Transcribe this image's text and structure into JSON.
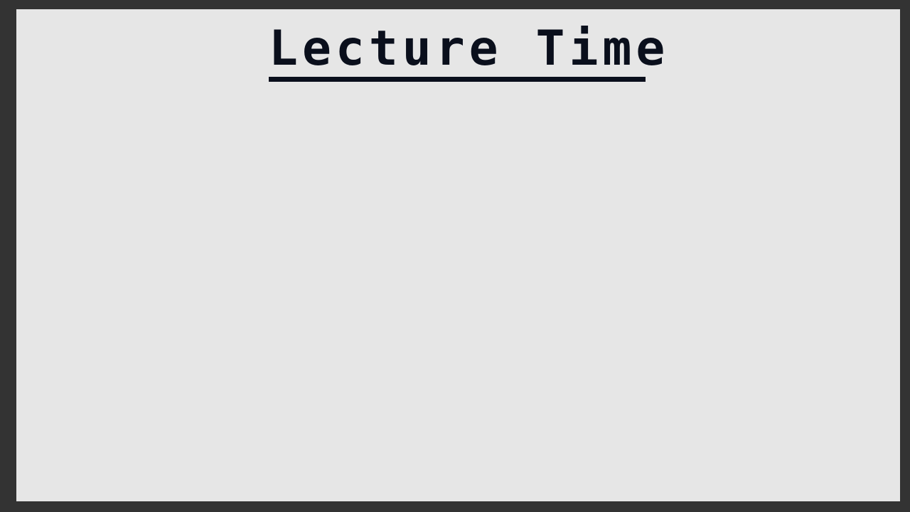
{
  "board": {
    "title": "Lecture Time"
  },
  "colors": {
    "frame": "#333333",
    "board": "#e6e6e6",
    "ink": "#0a0f1c"
  }
}
